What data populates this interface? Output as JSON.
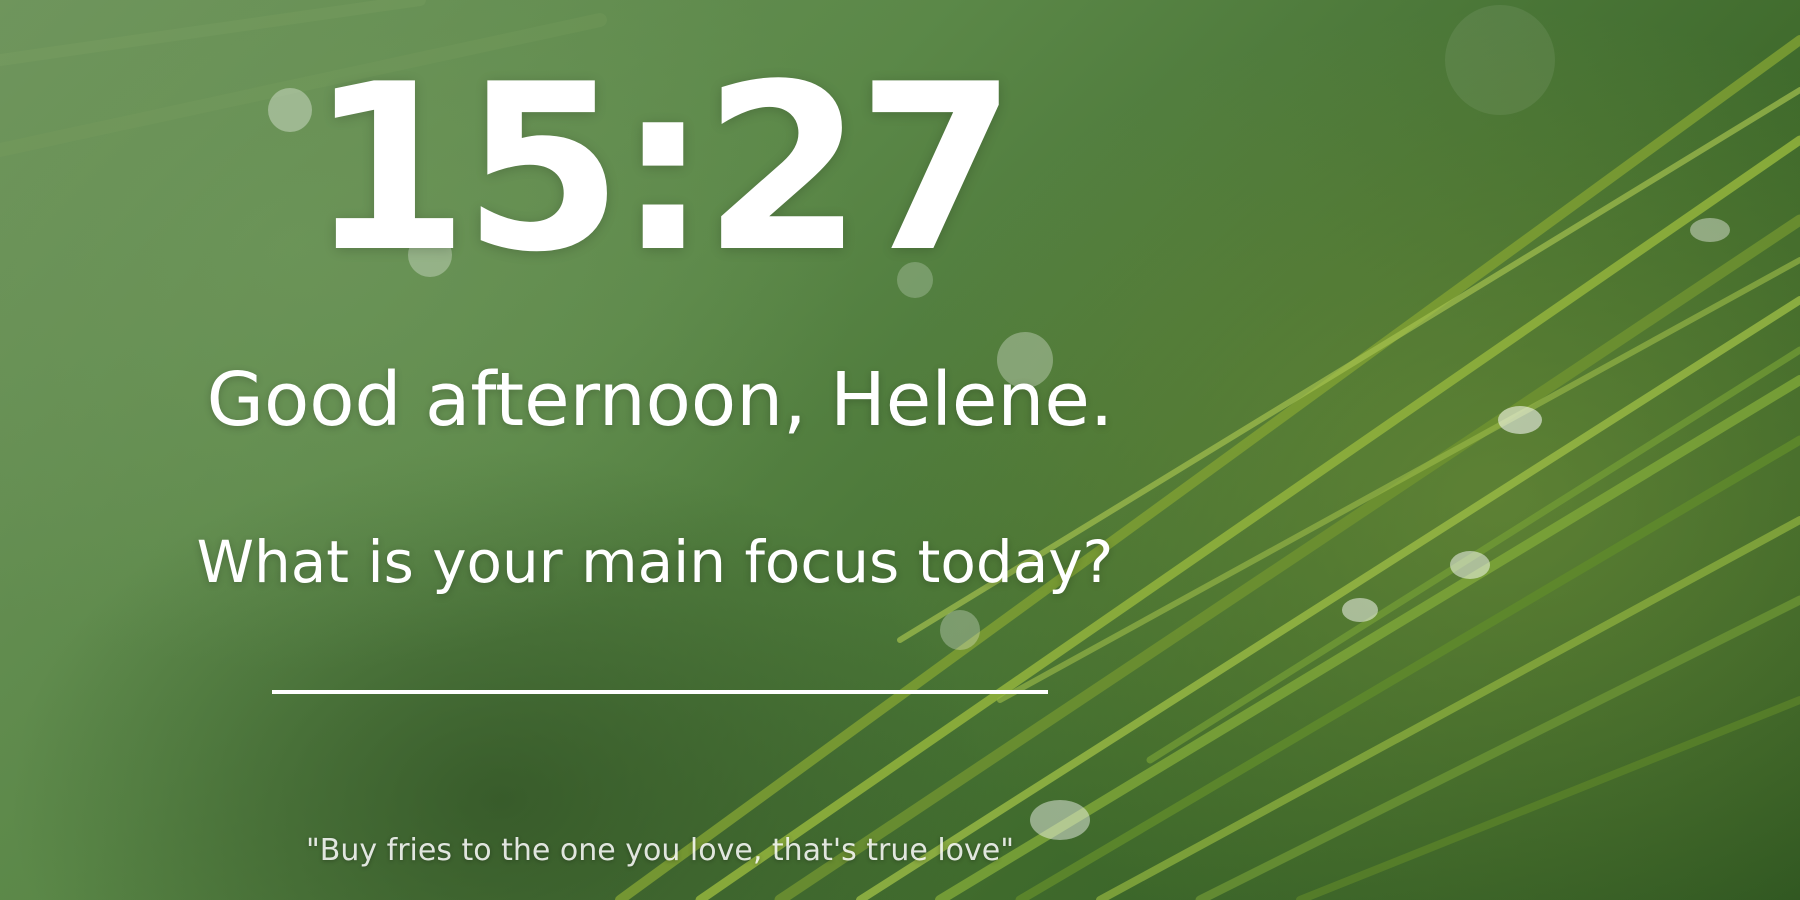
{
  "clock": {
    "time": "15:27"
  },
  "greeting": {
    "text": "Good afternoon, Helene."
  },
  "focus": {
    "question": "What is your main focus today?",
    "input_value": ""
  },
  "quote": {
    "text": "\"Buy fries to the one you love, that's true love\""
  },
  "colors": {
    "text": "#ffffff",
    "background_green": "#4f7a36",
    "needle_green": "#8fb03c"
  }
}
